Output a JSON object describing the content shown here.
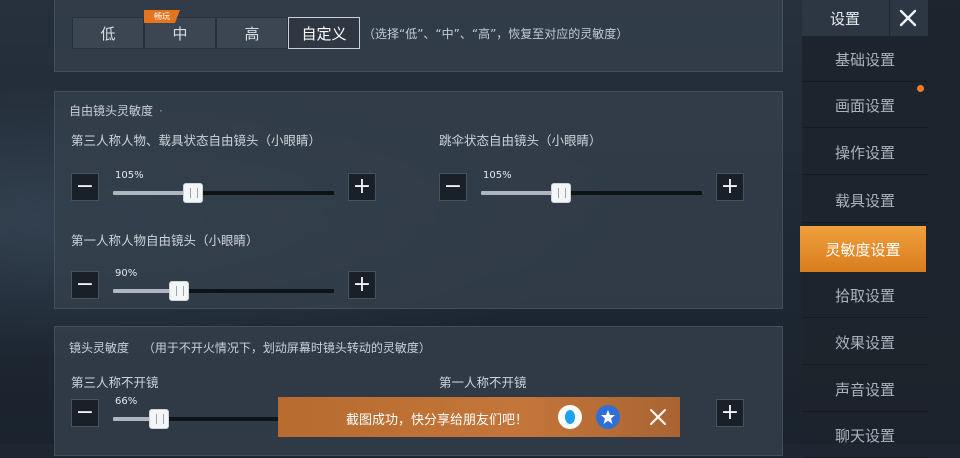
{
  "presets": {
    "badge": "畅玩",
    "options": [
      "低",
      "中",
      "高",
      "自定义"
    ],
    "selected_index": 3,
    "hint": "（选择“低”、“中”、“高”，恢复至对应的灵敏度）"
  },
  "free_camera": {
    "title": "自由镜头灵敏度",
    "sliders": [
      {
        "label": "第三人称人物、载具状态自由镜头（小眼睛）",
        "value_text": "105%",
        "value": 0.36
      },
      {
        "label": "跳伞状态自由镜头（小眼睛）",
        "value_text": "105%",
        "value": 0.36
      },
      {
        "label": "第一人称人物自由镜头（小眼睛）",
        "value_text": "90%",
        "value": 0.3
      }
    ]
  },
  "camera": {
    "title": "镜头灵敏度",
    "subtitle": "（用于不开火情况下，划动屏幕时镜头转动的灵敏度）",
    "sliders": [
      {
        "label": "第三人称不开镜",
        "value_text": "66%",
        "value": 0.21
      },
      {
        "label": "第一人称不开镜"
      }
    ]
  },
  "sidebar": {
    "title": "设置",
    "items": [
      {
        "label": "基础设置",
        "active": false
      },
      {
        "label": "画面设置",
        "active": false
      },
      {
        "label": "操作设置",
        "active": false
      },
      {
        "label": "载具设置",
        "active": false
      },
      {
        "label": "灵敏度设置",
        "active": true
      },
      {
        "label": "拾取设置",
        "active": false
      },
      {
        "label": "效果设置",
        "active": false
      },
      {
        "label": "声音设置",
        "active": false
      },
      {
        "label": "聊天设置",
        "active": false
      }
    ]
  },
  "toast": {
    "text": "截图成功，快分享给朋友们吧！"
  },
  "icons": {
    "minus": "minus-icon",
    "plus": "plus-icon",
    "close": "close-icon",
    "qq": "qq-icon",
    "qzone": "qzone-icon"
  },
  "colors": {
    "accent": "#e4741d",
    "active_tab": "#f0a03c",
    "panel": "#343f4c"
  }
}
